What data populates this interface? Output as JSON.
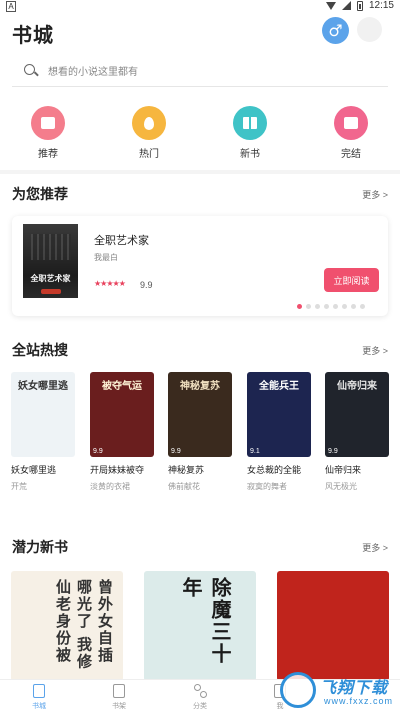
{
  "status_bar": {
    "left_badge": "A",
    "time": "12:15"
  },
  "header": {
    "title": "书城",
    "male_symbol": "♂"
  },
  "search": {
    "placeholder": "想看的小说这里都有"
  },
  "categories": [
    {
      "label": "推荐",
      "color": "#f47d8c"
    },
    {
      "label": "热门",
      "color": "#f6b63f"
    },
    {
      "label": "新书",
      "color": "#3fc3c7"
    },
    {
      "label": "完结",
      "color": "#f1668e"
    }
  ],
  "recommend": {
    "title": "为您推荐",
    "more": "更多 >",
    "book": {
      "name": "全职艺术家",
      "author": "我最白",
      "stars": "★★★★★",
      "score": "9.9",
      "cover_text": "全职艺术家"
    },
    "read_button": "立即阅读",
    "carousel": {
      "total": 8,
      "active": 0
    }
  },
  "hot": {
    "title": "全站热搜",
    "more": "更多 >",
    "books": [
      {
        "name": "妖女哪里逃",
        "author": "开荒",
        "cover_text": "妖女哪里逃",
        "score": "",
        "bg": "#eef3f6",
        "fg": "#333333"
      },
      {
        "name": "开局妹妹被夺",
        "author": "淡黄的衣裙",
        "cover_text": "被夺气运",
        "score": "9.9",
        "bg": "#6a1e1e",
        "fg": "#fff3d6"
      },
      {
        "name": "神秘复苏",
        "author": "佛前献花",
        "cover_text": "神秘复苏",
        "score": "9.9",
        "bg": "#3a2a1e",
        "fg": "#f0e0c0"
      },
      {
        "name": "女总裁的全能",
        "author": "寂寞的舞者",
        "cover_text": "全能兵王",
        "score": "9.1",
        "bg": "#1d2550",
        "fg": "#ffffff"
      },
      {
        "name": "仙帝归来",
        "author": "风无极光",
        "cover_text": "仙帝归来",
        "score": "9.9",
        "bg": "#20242c",
        "fg": "#e8e8e8"
      }
    ]
  },
  "new_books": {
    "title": "潜力新书",
    "more": "更多 >",
    "books": [
      {
        "cover_text": "曾外女自插哪光了 我修仙老身份被",
        "bg": "#f6f0e6",
        "fg": "#333333"
      },
      {
        "cover_text": "除魔三十年",
        "bg": "#dcebea",
        "fg": "#1a1a1a"
      },
      {
        "cover_text": "",
        "bg": "#c0241c",
        "fg": "#ffe0a0"
      }
    ]
  },
  "bottom_nav": [
    {
      "label": "书城",
      "active": true
    },
    {
      "label": "书架",
      "active": false
    },
    {
      "label": "分类",
      "active": false
    },
    {
      "label": "我",
      "active": false
    }
  ],
  "watermark": {
    "text": "飞翔下载",
    "sub": "www.fxxz.com"
  },
  "colors": {
    "accent": "#f0506e",
    "brand_blue": "#5ba3ea"
  }
}
